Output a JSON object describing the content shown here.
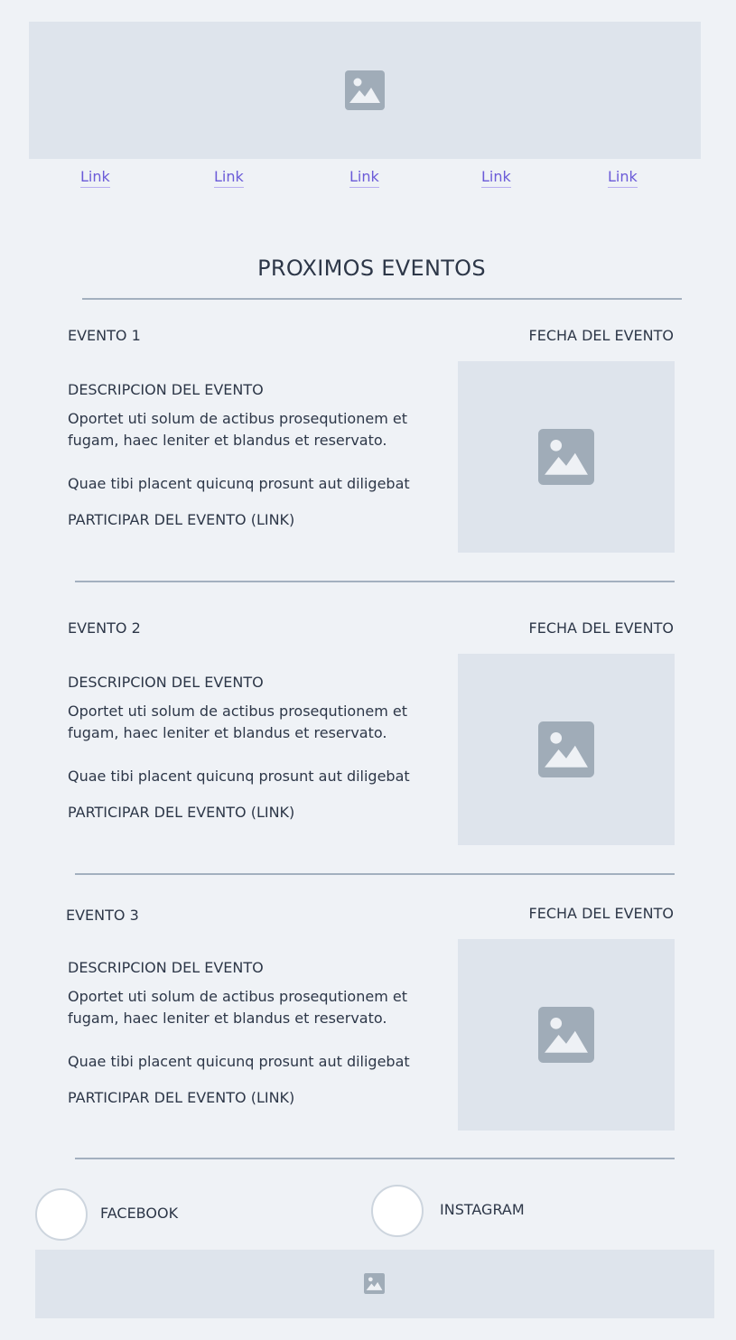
{
  "nav": {
    "links": [
      "Link",
      "Link",
      "Link",
      "Link",
      "Link"
    ]
  },
  "page": {
    "title": "PROXIMOS EVENTOS"
  },
  "events": [
    {
      "name": "EVENTO 1",
      "date": "FECHA DEL EVENTO",
      "desc_heading": "DESCRIPCION DEL EVENTO",
      "desc_line1": "Oportet uti solum de actibus prosequtionem et",
      "desc_line2": "fugam, haec leniter et blandus et reservato.",
      "extra": "Quae tibi placent quicunq prosunt aut diligebat",
      "cta": "PARTICIPAR DEL EVENTO (LINK)"
    },
    {
      "name": "EVENTO 2",
      "date": "FECHA DEL EVENTO",
      "desc_heading": "DESCRIPCION DEL EVENTO",
      "desc_line1": "Oportet uti solum de actibus prosequtionem et",
      "desc_line2": "fugam, haec leniter et blandus et reservato.",
      "extra": "Quae tibi placent quicunq prosunt aut diligebat",
      "cta": "PARTICIPAR DEL EVENTO (LINK)"
    },
    {
      "name": "EVENTO 3",
      "date": "FECHA DEL EVENTO",
      "desc_heading": "DESCRIPCION DEL EVENTO",
      "desc_line1": "Oportet uti solum de actibus prosequtionem et",
      "desc_line2": "fugam, haec leniter et blandus et reservato.",
      "extra": "Quae tibi placent quicunq prosunt aut diligebat",
      "cta": "PARTICIPAR DEL EVENTO (LINK)"
    }
  ],
  "social": {
    "facebook": "FACEBOOK",
    "instagram": "INSTAGRAM"
  },
  "icons": {
    "image_placeholder": "image-icon"
  },
  "colors": {
    "link": "#6b5bd8",
    "placeholder_bg": "#dee4ec",
    "icon": "#a0acb8",
    "rule": "#a3b0bf"
  }
}
